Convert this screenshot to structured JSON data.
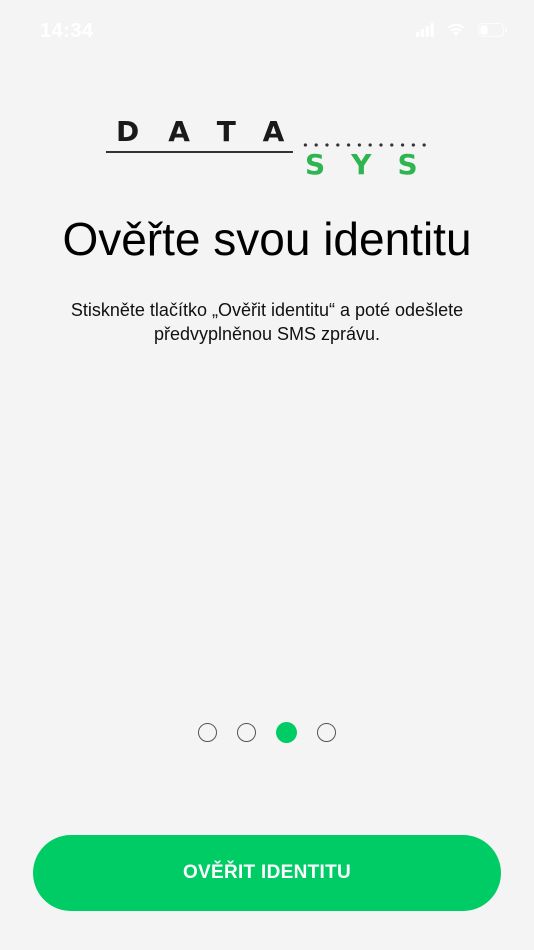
{
  "status_bar": {
    "time": "14:34",
    "icons": [
      "cellular-signal-icon",
      "wifi-icon",
      "battery-icon"
    ]
  },
  "logo": {
    "word_top": "DATA",
    "word_bottom": "SYS",
    "brand_color": "#2eb552"
  },
  "content": {
    "title": "Ověřte svou identitu",
    "description": "Stiskněte tlačítko „Ověřit identitu“ a poté odešlete předvyplněnou SMS zprávu."
  },
  "pager": {
    "total": 4,
    "active_index": 2
  },
  "actions": {
    "verify_label": "OVĚŘIT IDENTITU"
  },
  "colors": {
    "accent": "#00cc66",
    "background": "#f4f4f4"
  }
}
